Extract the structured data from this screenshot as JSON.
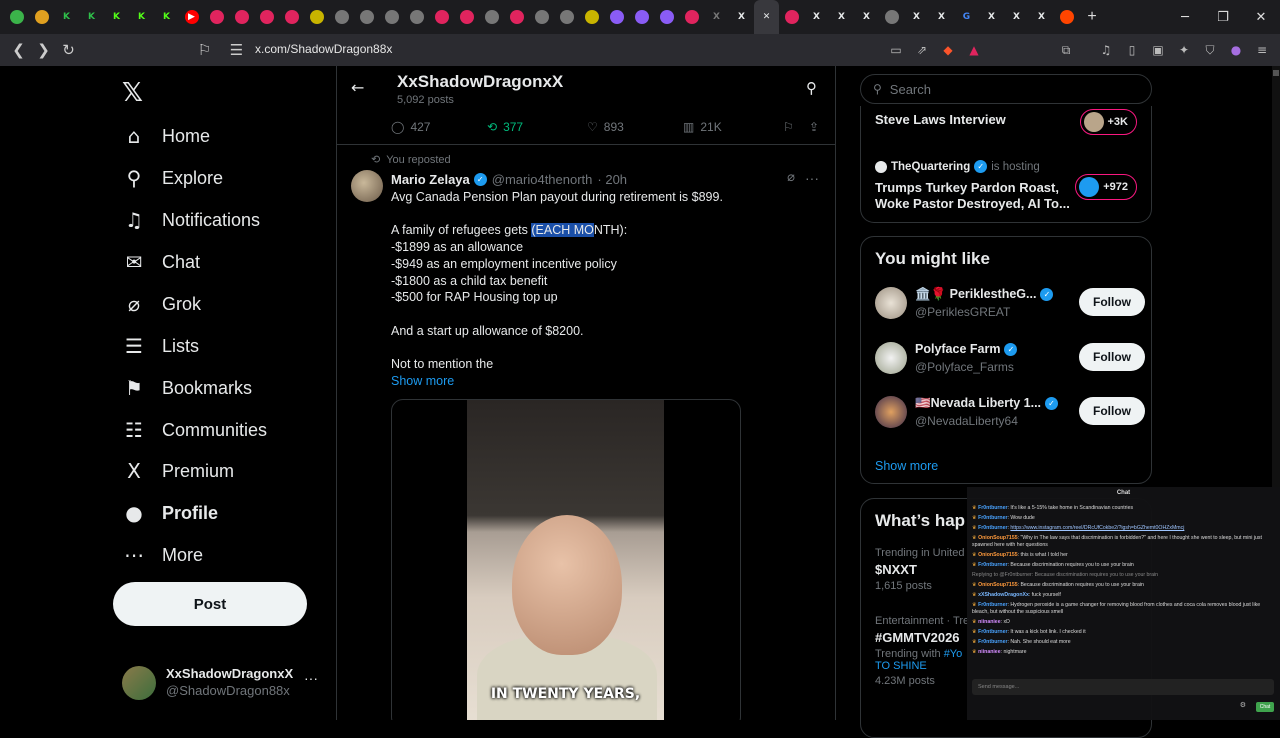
{
  "browser": {
    "tabs": [
      {
        "color": "#3bb34a",
        "glyph": "●"
      },
      {
        "color": "#e0a020",
        "glyph": "●"
      },
      {
        "color": "#2fbf4a",
        "glyph": "K"
      },
      {
        "color": "#2fbf4a",
        "glyph": "K"
      },
      {
        "color": "#53fc18",
        "glyph": "K"
      },
      {
        "color": "#53fc18",
        "glyph": "K"
      },
      {
        "color": "#53fc18",
        "glyph": "K"
      },
      {
        "color": "#ff0000",
        "glyph": "▶"
      },
      {
        "color": "#e0245e",
        "glyph": "●"
      },
      {
        "color": "#e0245e",
        "glyph": "●"
      },
      {
        "color": "#e0245e",
        "glyph": "●"
      },
      {
        "color": "#e0245e",
        "glyph": "●"
      },
      {
        "color": "#c8b400",
        "glyph": "●"
      },
      {
        "color": "#777777",
        "glyph": "●"
      },
      {
        "color": "#777777",
        "glyph": "●"
      },
      {
        "color": "#777777",
        "glyph": "●"
      },
      {
        "color": "#777777",
        "glyph": "●"
      },
      {
        "color": "#e0245e",
        "glyph": "●"
      },
      {
        "color": "#e0245e",
        "glyph": "●"
      },
      {
        "color": "#777777",
        "glyph": "●"
      },
      {
        "color": "#e0245e",
        "glyph": "●"
      },
      {
        "color": "#777777",
        "glyph": "●"
      },
      {
        "color": "#777777",
        "glyph": "●"
      },
      {
        "color": "#c8b400",
        "glyph": "●"
      },
      {
        "color": "#8a5cf5",
        "glyph": "●"
      },
      {
        "color": "#8a5cf5",
        "glyph": "●"
      },
      {
        "color": "#8a5cf5",
        "glyph": "●"
      },
      {
        "color": "#e0245e",
        "glyph": "●"
      },
      {
        "color": "#777777",
        "glyph": "X"
      },
      {
        "color": "#e7e9ea",
        "glyph": "X"
      },
      {
        "color": "#e7e9ea",
        "glyph": "✕"
      },
      {
        "color": "#e0245e",
        "glyph": "●"
      },
      {
        "color": "#e7e9ea",
        "glyph": "X"
      },
      {
        "color": "#e7e9ea",
        "glyph": "X"
      },
      {
        "color": "#e7e9ea",
        "glyph": "X"
      },
      {
        "color": "#777777",
        "glyph": "●"
      },
      {
        "color": "#e7e9ea",
        "glyph": "X"
      },
      {
        "color": "#e7e9ea",
        "glyph": "X"
      },
      {
        "color": "#4285f4",
        "glyph": "G"
      },
      {
        "color": "#e7e9ea",
        "glyph": "X"
      },
      {
        "color": "#e7e9ea",
        "glyph": "X"
      },
      {
        "color": "#e7e9ea",
        "glyph": "X"
      },
      {
        "color": "#ff4500",
        "glyph": "●"
      }
    ],
    "new_tab": "+",
    "url": "x.com/ShadowDragon88x",
    "notification_count": "1"
  },
  "nav": {
    "items": [
      {
        "label": "Home",
        "icon": "⌂",
        "name": "home"
      },
      {
        "label": "Explore",
        "icon": "⚲",
        "name": "explore"
      },
      {
        "label": "Notifications",
        "icon": "♫",
        "name": "notifications"
      },
      {
        "label": "Chat",
        "icon": "✉",
        "name": "chat"
      },
      {
        "label": "Grok",
        "icon": "⌀",
        "name": "grok"
      },
      {
        "label": "Lists",
        "icon": "☰",
        "name": "lists"
      },
      {
        "label": "Bookmarks",
        "icon": "⚑",
        "name": "bookmarks"
      },
      {
        "label": "Communities",
        "icon": "☷",
        "name": "communities"
      },
      {
        "label": "Premium",
        "icon": "X",
        "name": "premium"
      },
      {
        "label": "Profile",
        "icon": "●",
        "name": "profile"
      },
      {
        "label": "More",
        "icon": "⋯",
        "name": "more"
      }
    ],
    "post_label": "Post",
    "account": {
      "name": "XxShadowDragonxX",
      "handle": "@ShadowDragon88x",
      "more": "···"
    }
  },
  "profile_header": {
    "title": "XxShadowDragonxX",
    "posts": "5,092 posts"
  },
  "prev_actions": {
    "replies": "427",
    "reposts": "377",
    "likes": "893",
    "views": "21K"
  },
  "tweet": {
    "repost_indicator": "You reposted",
    "author": "Mario Zelaya",
    "handle": "@mario4thenorth",
    "time": "· 20h",
    "line1": "Avg Canada Pension Plan payout during retirement is $899.",
    "line2_pre": "A family of refugees gets ",
    "line2_hl": "(EACH MO",
    "line2_post": "NTH):",
    "items": [
      "-$1899 as an allowance",
      "-$949 as an employment incentive policy",
      "-$1800 as a child tax benefit",
      "-$500 for RAP Housing top up"
    ],
    "line3": "And a start up allowance of $8200.",
    "line4": "Not to mention the",
    "show_more": "Show more",
    "video_caption": "IN TWENTY YEARS,"
  },
  "search": {
    "placeholder": "Search"
  },
  "spaces": {
    "space1_title": "Steve Laws Interview",
    "space1_count": "+3K",
    "host_name": "TheQuartering",
    "host_text": "is hosting",
    "space2_title": "Trumps Turkey Pardon Roast, Woke Pastor Destroyed, AI To...",
    "space2_count": "+972"
  },
  "who_to_follow": {
    "title": "You might like",
    "items": [
      {
        "name": "🏛️🌹 PeriklestheG...",
        "handle": "@PeriklesGREAT",
        "follow": "Follow"
      },
      {
        "name": "Polyface Farm",
        "handle": "@Polyface_Farms",
        "follow": "Follow"
      },
      {
        "name": "🇺🇸Nevada Liberty 1...",
        "handle": "@NevadaLiberty64",
        "follow": "Follow"
      }
    ],
    "show_more": "Show more"
  },
  "trends": {
    "title": "What’s hap",
    "items": [
      {
        "context": "Trending in United",
        "title": "$NXXT",
        "count": "1,615 posts"
      },
      {
        "context": "Entertainment · Tre",
        "title": "#GMMTV2026",
        "extra_prefix": "Trending with",
        "extra_tag": "#Yo",
        "extra2": "TO SHINE",
        "count": "4.23M posts"
      }
    ]
  },
  "chat": {
    "title": "Chat",
    "messages": [
      {
        "user": "Fr0ntburner",
        "text": ": It's like a 5-15% take home in Scandinavian countries"
      },
      {
        "user": "Fr0ntburner",
        "text": ": Wow dude"
      },
      {
        "user": "Fr0ntburner",
        "text": ": ",
        "link": "https://www.instagram.com/reel/DRcUfCokbe2/?igsh=bGZhemt0OHZxMmcj"
      },
      {
        "user": "OnionSoup7155",
        "text": ": \"Why in The law says that discrimination is forbidden?\" and here I thought she went to sleep, but mini just spawned here with her questions"
      },
      {
        "user": "OnionSoup7155",
        "text": ": this is what I told her"
      },
      {
        "user": "Fr0ntburner",
        "text": ": Because discrimination requires you to use your brain"
      },
      {
        "user": "",
        "text": "Replying to @Fr0ntburner: Because discrimination requires you to use your brain",
        "sys": true
      },
      {
        "user": "OnionSoup7155",
        "text": ": Because discrimination requires you to use your brain"
      },
      {
        "user": "xXShadowDragonXx",
        "text": ": fuck yourself"
      },
      {
        "user": "Fr0ntburner",
        "text": ": Hydrogen peroxide is a game changer for removing blood from clothes and coca cola removes blood just like bleach, but without the suspicious smell"
      },
      {
        "user": "niinaniee",
        "text": ": xD"
      },
      {
        "user": "Fr0ntburner",
        "text": ": It was a kick bot link. I checked it"
      },
      {
        "user": "Fr0ntburner",
        "text": ": Nah. She should eat more"
      },
      {
        "user": "niinaniee",
        "text": ": nightmare"
      }
    ],
    "input_placeholder": "Send message...",
    "send_label": "Chat"
  }
}
